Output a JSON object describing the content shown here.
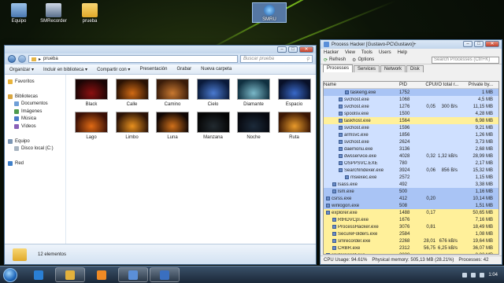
{
  "desktop": {
    "icons": [
      {
        "label": "Equipo"
      },
      {
        "label": "SMRecorder"
      },
      {
        "label": "prueba"
      }
    ],
    "active_icon": {
      "label": "SMRU"
    }
  },
  "explorer": {
    "path": "prueba",
    "search_placeholder": "Buscar prueba",
    "toolbar": [
      "Organizar ▾",
      "Incluir en biblioteca ▾",
      "Compartir con ▾",
      "Presentación",
      "Grabar",
      "Nueva carpeta"
    ],
    "nav": [
      {
        "label": "Favoritos",
        "color": "#e8b33a"
      },
      {
        "label": "",
        "color": ""
      },
      {
        "label": "Bibliotecas",
        "color": "#d9a640"
      },
      {
        "label": "Documentos",
        "color": "#6f9fd8"
      },
      {
        "label": "Imágenes",
        "color": "#4e9a4e"
      },
      {
        "label": "Música",
        "color": "#4a7ac8"
      },
      {
        "label": "Vídeos",
        "color": "#8860b8"
      },
      {
        "label": "",
        "color": ""
      },
      {
        "label": "Equipo",
        "color": "#7c96b4"
      },
      {
        "label": "Disco local (C:)",
        "color": "#a8b4c0"
      },
      {
        "label": "",
        "color": ""
      },
      {
        "label": "Red",
        "color": "#3f7fc8"
      }
    ],
    "files": [
      {
        "name": "Black",
        "color1": "#1a0505",
        "color2": "#8b1010"
      },
      {
        "name": "Calle",
        "color1": "#2a1204",
        "color2": "#d06a14"
      },
      {
        "name": "Camino",
        "color1": "#3a1c0a",
        "color2": "#c87830"
      },
      {
        "name": "Cielo",
        "color1": "#0a1a3a",
        "color2": "#4a7ad0"
      },
      {
        "name": "Diamante",
        "color1": "#103040",
        "color2": "#7ab8c8"
      },
      {
        "name": "Espacio",
        "color1": "#081028",
        "color2": "#3868c8"
      },
      {
        "name": "Lago",
        "color1": "#3a1006",
        "color2": "#e06a14"
      },
      {
        "name": "Limbo",
        "color1": "#2a1206",
        "color2": "#e8901e"
      },
      {
        "name": "Luna",
        "color1": "#100604",
        "color2": "#d0701a"
      },
      {
        "name": "Manzana",
        "color1": "#050505",
        "color2": "#222a30"
      },
      {
        "name": "Noche",
        "color1": "#06080e",
        "color2": "#1c2a3a"
      },
      {
        "name": "Ruta",
        "color1": "#3a1604",
        "color2": "#e89a2a"
      }
    ],
    "status": "12 elementos"
  },
  "process_hacker": {
    "title": "Process Hacker [Gustavo-PC\\Gustavo]+",
    "menu": [
      "Hacker",
      "View",
      "Tools",
      "Users",
      "Help"
    ],
    "toolbar": {
      "refresh": "Refresh",
      "options": "Options",
      "search_placeholder": "Search Processes (Ctrl+K)"
    },
    "tabs": [
      "Processes",
      "Services",
      "Network",
      "Disk"
    ],
    "columns": [
      "Name",
      "PID",
      "CPU",
      "I/O total r...",
      "Private by..."
    ],
    "rows": [
      {
        "name": "taskeng.exe",
        "pid": "1752",
        "cpu": "",
        "io": "",
        "priv": "1 MB",
        "indent": 3,
        "bg": "#a9c4f5"
      },
      {
        "name": "svchost.exe",
        "pid": "1068",
        "cpu": "",
        "io": "",
        "priv": "4,5 MB",
        "indent": 2,
        "bg": "#cfe0ff"
      },
      {
        "name": "svchost.exe",
        "pid": "1276",
        "cpu": "0,05",
        "io": "300 B/s",
        "priv": "11,15 MB",
        "indent": 2,
        "bg": "#cfe0ff"
      },
      {
        "name": "spoolsv.exe",
        "pid": "1500",
        "cpu": "",
        "io": "",
        "priv": "4,28 MB",
        "indent": 2,
        "bg": "#cfe0ff"
      },
      {
        "name": "taskhost.exe",
        "pid": "1564",
        "cpu": "",
        "io": "",
        "priv": "6,98 MB",
        "indent": 2,
        "bg": "#fff09a"
      },
      {
        "name": "svchost.exe",
        "pid": "1596",
        "cpu": "",
        "io": "",
        "priv": "9,21 MB",
        "indent": 2,
        "bg": "#cfe0ff"
      },
      {
        "name": "armsvc.exe",
        "pid": "1856",
        "cpu": "",
        "io": "",
        "priv": "1,26 MB",
        "indent": 2,
        "bg": "#cfe0ff"
      },
      {
        "name": "svchost.exe",
        "pid": "2624",
        "cpu": "",
        "io": "",
        "priv": "3,73 MB",
        "indent": 2,
        "bg": "#cfe0ff"
      },
      {
        "name": "daemonu.exe",
        "pid": "3136",
        "cpu": "",
        "io": "",
        "priv": "2,68 MB",
        "indent": 2,
        "bg": "#cfe0ff"
      },
      {
        "name": "dwsservice.exe",
        "pid": "4028",
        "cpu": "0,32",
        "io": "1,32 kB/s",
        "priv": "28,99 MB",
        "indent": 2,
        "bg": "#cfe0ff"
      },
      {
        "name": "OSPPSVC.EXE",
        "pid": "780",
        "cpu": "",
        "io": "",
        "priv": "2,17 MB",
        "indent": 2,
        "bg": "#cfe0ff"
      },
      {
        "name": "SearchIndexer.exe",
        "pid": "3924",
        "cpu": "0,06",
        "io": "856 B/s",
        "priv": "15,32 MB",
        "indent": 2,
        "bg": "#cfe0ff"
      },
      {
        "name": "msiexec.exe",
        "pid": "2572",
        "cpu": "",
        "io": "",
        "priv": "1,15 MB",
        "indent": 3,
        "bg": "#cfe0ff"
      },
      {
        "name": "lsass.exe",
        "pid": "492",
        "cpu": "",
        "io": "",
        "priv": "3,38 MB",
        "indent": 1,
        "bg": "#cfe0ff"
      },
      {
        "name": "lsm.exe",
        "pid": "500",
        "cpu": "",
        "io": "",
        "priv": "1,16 MB",
        "indent": 1,
        "bg": "#a9c4f5"
      },
      {
        "name": "csrss.exe",
        "pid": "412",
        "cpu": "0,20",
        "io": "",
        "priv": "10,14 MB",
        "indent": 0,
        "bg": "#a9c4f5"
      },
      {
        "name": "winlogon.exe",
        "pid": "508",
        "cpu": "",
        "io": "",
        "priv": "1,51 MB",
        "indent": 0,
        "bg": "#a9c4f5"
      },
      {
        "name": "explorer.exe",
        "pid": "1488",
        "cpu": "0,17",
        "io": "",
        "priv": "50,65 MB",
        "indent": 0,
        "bg": "#fff09a"
      },
      {
        "name": "RtHDVCpl.exe",
        "pid": "1676",
        "cpu": "",
        "io": "",
        "priv": "7,16 MB",
        "indent": 1,
        "bg": "#fff09a"
      },
      {
        "name": "ProcessHacker.exe",
        "pid": "3076",
        "cpu": "0,81",
        "io": "",
        "priv": "18,49 MB",
        "indent": 1,
        "bg": "#fff09a"
      },
      {
        "name": "SecureFolders.exe",
        "pid": "2584",
        "cpu": "",
        "io": "",
        "priv": "1,08 MB",
        "indent": 1,
        "bg": "#fff09a"
      },
      {
        "name": "smrecorder.exe",
        "pid": "2268",
        "cpu": "28,01",
        "io": "676 kB/s",
        "priv": "19,64 MB",
        "indent": 1,
        "bg": "#fff09a"
      },
      {
        "name": "CRBR.exe",
        "pid": "2312",
        "cpu": "56,75",
        "io": "6,25 kB/s",
        "priv": "36,07 MB",
        "indent": 1,
        "bg": "#fff09a"
      },
      {
        "name": "spideragent.exe",
        "pid": "2828",
        "cpu": "",
        "io": "",
        "priv": "8,82 MB",
        "indent": 0,
        "bg": "#fff09a"
      }
    ],
    "status": {
      "cpu": "CPU Usage: 94.61%",
      "mem": "Physical memory: 505,13 MB (28.21%)",
      "procs": "Processes: 42"
    }
  },
  "taskbar": {
    "apps": [
      {
        "name": "internet-explorer",
        "color": "#2a7fd4",
        "open": false
      },
      {
        "name": "windows-explorer",
        "color": "#e3b13c",
        "open": true
      },
      {
        "name": "media-player",
        "color": "#f08a24",
        "open": false
      },
      {
        "name": "process-hacker",
        "color": "#5b8fd8",
        "open": true
      },
      {
        "name": "smrecorder",
        "color": "#3a6fc0",
        "open": true
      }
    ],
    "clock": "1:04"
  }
}
